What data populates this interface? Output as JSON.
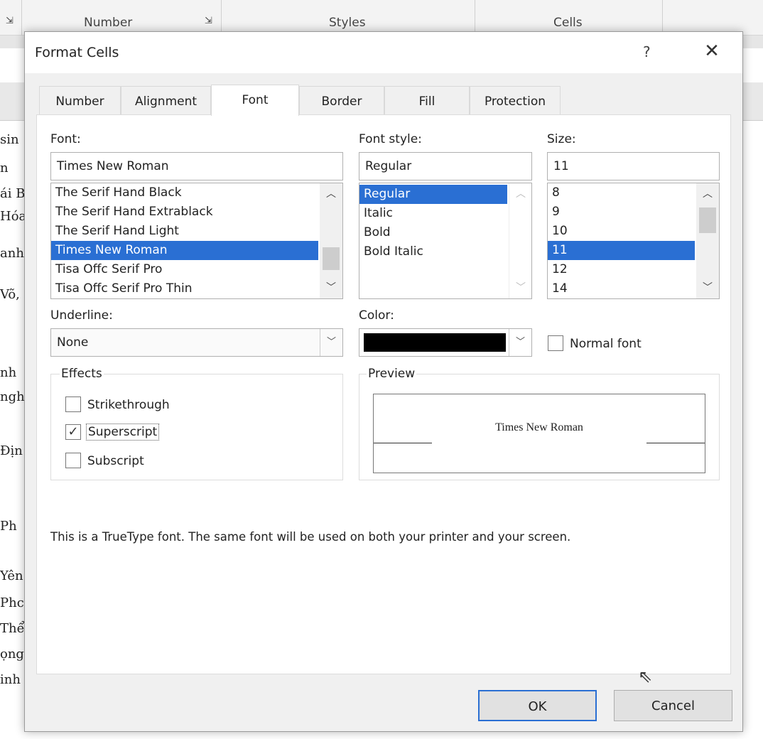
{
  "ribbon": {
    "groups": [
      "Number",
      "Styles",
      "Cells"
    ]
  },
  "background_text": [
    "sin",
    "n",
    "ái B",
    "Hóa",
    "anh",
    "Võ,",
    "nh",
    "nghệ",
    "Địn",
    "Ph",
    "Yên",
    "Phc",
    "Thể",
    "ọng",
    "inh"
  ],
  "dialog": {
    "title": "Format Cells",
    "help": "?",
    "close": "✕",
    "tabs": [
      "Number",
      "Alignment",
      "Font",
      "Border",
      "Fill",
      "Protection"
    ],
    "active_tab": "Font",
    "font": {
      "label": "Font:",
      "value": "Times New Roman",
      "options": [
        "The Serif Hand Black",
        "The Serif Hand Extrablack",
        "The Serif Hand Light",
        "Times New Roman",
        "Tisa Offc Serif Pro",
        "Tisa Offc Serif Pro Thin"
      ],
      "selected": "Times New Roman"
    },
    "font_style": {
      "label": "Font style:",
      "value": "Regular",
      "options": [
        "Regular",
        "Italic",
        "Bold",
        "Bold Italic"
      ],
      "selected": "Regular"
    },
    "size": {
      "label": "Size:",
      "value": "11",
      "options": [
        "8",
        "9",
        "10",
        "11",
        "12",
        "14"
      ],
      "selected": "11"
    },
    "underline": {
      "label": "Underline:",
      "value": "None"
    },
    "color": {
      "label": "Color:",
      "value": "#000000"
    },
    "normal_font": {
      "label": "Normal font",
      "checked": false
    },
    "effects": {
      "label": "Effects",
      "strikethrough": {
        "label": "Strikethrough",
        "checked": false
      },
      "superscript": {
        "label": "Superscript",
        "checked": true
      },
      "subscript": {
        "label": "Subscript",
        "checked": false
      }
    },
    "preview": {
      "label": "Preview",
      "text": "Times New Roman"
    },
    "info": "This is a TrueType font.  The same font will be used on both your printer and your screen.",
    "ok": "OK",
    "cancel": "Cancel"
  }
}
